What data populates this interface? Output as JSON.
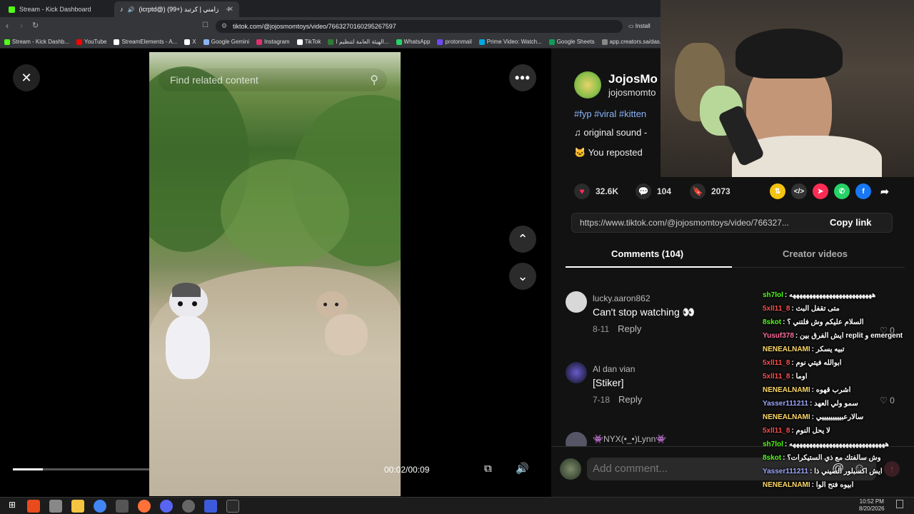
{
  "browser": {
    "tabs": [
      {
        "label": "Stream - Kick Dashboard",
        "icon": "kick-icon"
      },
      {
        "label": "(icrptd@) زامني | كرتبد (+99)",
        "icon": "tiktok-icon"
      }
    ],
    "url": "tiktok.com/@jojosmomtoys/video/7663270160295267597",
    "install_label": "Install",
    "bookmarks": [
      {
        "label": "Stream - Kick Dashb...",
        "color": "#53fc18"
      },
      {
        "label": "YouTube",
        "color": "#ff0000"
      },
      {
        "label": "StreamElements - A...",
        "color": "#ffffff"
      },
      {
        "label": "X",
        "color": "#ffffff"
      },
      {
        "label": "Google Gemini",
        "color": "#8ab4f8"
      },
      {
        "label": "Instagram",
        "color": "#e1306c"
      },
      {
        "label": "TikTok",
        "color": "#ffffff"
      },
      {
        "label": "الهيئة العامة لتنظيم ا...",
        "color": "#2e7d32"
      },
      {
        "label": "WhatsApp",
        "color": "#25d366"
      },
      {
        "label": "protonmail",
        "color": "#6d4aff"
      },
      {
        "label": "Prime Video: Watch...",
        "color": "#00a8e1"
      },
      {
        "label": "Google Sheets",
        "color": "#0f9d58"
      },
      {
        "label": "app.creators.sa/das...",
        "color": "#888888"
      }
    ]
  },
  "video": {
    "search_placeholder": "Find related content",
    "time": "00:02/00:09",
    "progress": 0.222
  },
  "creator": {
    "name": "JojosMo",
    "handle": "jojosmomto",
    "tags": "#fyp #viral #kitten",
    "sound": "original sound - ",
    "repost": "You reposted"
  },
  "stats": {
    "likes": "32.6K",
    "comments": "104",
    "saves": "2073"
  },
  "share": {
    "link": "https://www.tiktok.com/@jojosmomtoys/video/766327...",
    "copy_label": "Copy link"
  },
  "tabs": {
    "comments": "Comments (104)",
    "creator_videos": "Creator videos"
  },
  "comments": [
    {
      "user": "lucky.aaron862",
      "text": "Can't stop watching 👀",
      "date": "8-11",
      "reply": "Reply",
      "likes": "0"
    },
    {
      "user": "Al dan vian",
      "text": "[Stiker]",
      "date": "7-18",
      "reply": "Reply",
      "likes": "0"
    },
    {
      "user": "👾NYX(•_•)Lynn👾",
      "text": "",
      "date": "",
      "reply": "",
      "likes": ""
    }
  ],
  "add_comment_placeholder": "Add comment...",
  "chat": [
    {
      "user": "sh7lol",
      "msg": ": هههههههههههههههههههههههههه",
      "color": "#53fc18"
    },
    {
      "user": "5xll11_8",
      "msg": ": متى تقفل البث",
      "color": "#ff4d4d"
    },
    {
      "user": "8skot",
      "msg": ": السلام عليكم وش فلتني ؟",
      "color": "#53fc18"
    },
    {
      "user": "Yusuf378",
      "msg": ": ايش الفرق بين replit و emergent",
      "color": "#ff6b9d"
    },
    {
      "user": "NENEALNAMI",
      "msg": ": تبيه يسكر",
      "color": "#ffd966"
    },
    {
      "user": "5xll11_8",
      "msg": ": ابوالله فيتي نوم",
      "color": "#ff4d4d"
    },
    {
      "user": "5xll11_8",
      "msg": ": اوما",
      "color": "#ff4d4d"
    },
    {
      "user": "NENEALNAMI",
      "msg": ": اشرب قهوه",
      "color": "#ffd966"
    },
    {
      "user": "Yasser111211",
      "msg": ": سمو ولي العهد",
      "color": "#9fa8ff"
    },
    {
      "user": "NENEALNAMI",
      "msg": ": سالارعبيييييييييي",
      "color": "#ffd966"
    },
    {
      "user": "5xll11_8",
      "msg": ": لا يحل النوم",
      "color": "#ff4d4d"
    },
    {
      "user": "sh7lol",
      "msg": ": هههههههههههههههههههههههههههههه",
      "color": "#53fc18"
    },
    {
      "user": "8skot",
      "msg": ": وش سالفتك مع ذي الستيكرات؟",
      "color": "#53fc18"
    },
    {
      "user": "Yasser111211",
      "msg": ": ايش اكسبلور الصيني ذا",
      "color": "#9fa8ff"
    },
    {
      "user": "NENEALNAMI",
      "msg": ": ابيوه فتح الوا",
      "color": "#ffd966"
    }
  ],
  "clock": {
    "time": "10:52 PM",
    "date": "8/20/2026"
  }
}
